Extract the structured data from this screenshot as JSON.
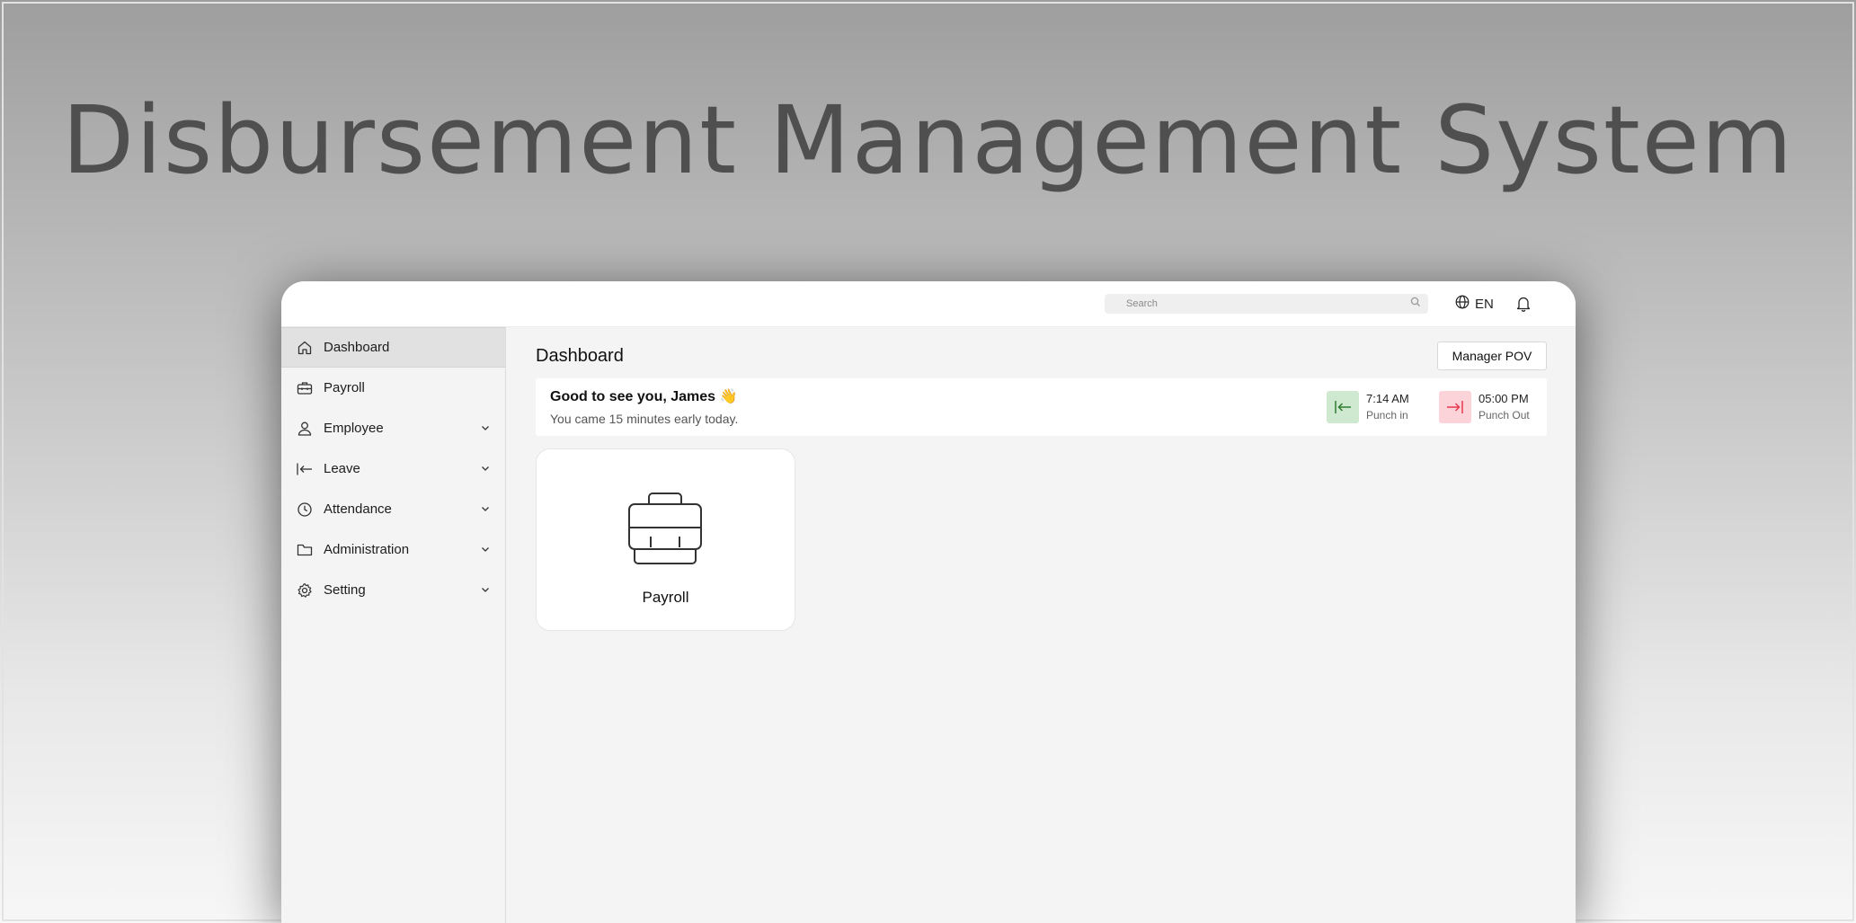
{
  "hero": {
    "title": "Disbursement Management System"
  },
  "topbar": {
    "search_placeholder": "Search",
    "language": "EN"
  },
  "sidebar": {
    "items": [
      {
        "label": "Dashboard",
        "icon": "home-icon",
        "active": true,
        "expandable": false
      },
      {
        "label": "Payroll",
        "icon": "briefcase-icon",
        "active": false,
        "expandable": false
      },
      {
        "label": "Employee",
        "icon": "user-icon",
        "active": false,
        "expandable": true
      },
      {
        "label": "Leave",
        "icon": "arrow-left-bar-icon",
        "active": false,
        "expandable": true
      },
      {
        "label": "Attendance",
        "icon": "clock-icon",
        "active": false,
        "expandable": true
      },
      {
        "label": "Administration",
        "icon": "folder-icon",
        "active": false,
        "expandable": true
      },
      {
        "label": "Setting",
        "icon": "gear-icon",
        "active": false,
        "expandable": true
      }
    ]
  },
  "main": {
    "title": "Dashboard",
    "pov_button": "Manager POV",
    "welcome": {
      "greeting": "Good to see you, James 👋",
      "subtitle": "You came 15 minutes early today.",
      "punch_in": {
        "time": "7:14 AM",
        "label": "Punch in"
      },
      "punch_out": {
        "time": "05:00 PM",
        "label": "Punch Out"
      }
    },
    "tiles": [
      {
        "label": "Payroll",
        "icon": "briefcase-icon"
      }
    ]
  },
  "colors": {
    "punch_in_bg": "#cfe8d0",
    "punch_in_fg": "#2e7d32",
    "punch_out_bg": "#fbd3d9",
    "punch_out_fg": "#e53950"
  }
}
